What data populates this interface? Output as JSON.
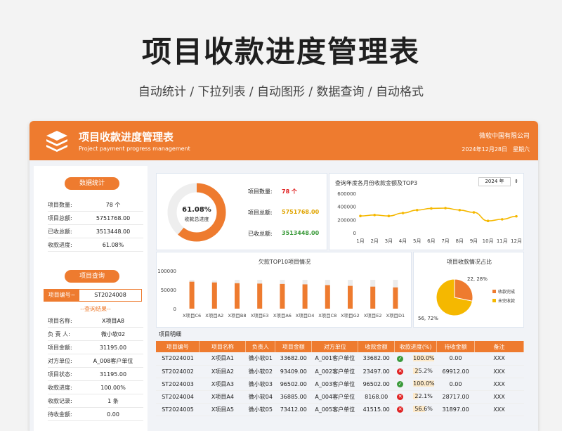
{
  "title": "项目收款进度管理表",
  "subtitle": "自动统计 / 下拉列表 / 自动图形 / 数据查询 / 自动格式",
  "header": {
    "title": "项目收款进度管理表",
    "subtitle": "Project payment progress management",
    "company": "微软中国有限公司",
    "date": "2024年12月28日　星期六"
  },
  "stats": {
    "label": "数据统计",
    "items": [
      {
        "k": "项目数量:",
        "v": "78 个"
      },
      {
        "k": "项目总额:",
        "v": "5751768.00"
      },
      {
        "k": "已收总额:",
        "v": "3513448.00"
      },
      {
        "k": "收款进度:",
        "v": "61.08%"
      }
    ]
  },
  "query": {
    "label": "项目查询",
    "key": "项目编号~",
    "value": "ST2024008",
    "divider": "--查询结果--",
    "items": [
      {
        "k": "项目名称:",
        "v": "X项目A8"
      },
      {
        "k": "负 责 人:",
        "v": "微小软02"
      },
      {
        "k": "项目金额:",
        "v": "31195.00"
      },
      {
        "k": "对方单位:",
        "v": "A_008客户单位"
      },
      {
        "k": "项目状态:",
        "v": "31195.00"
      },
      {
        "k": "收款进度:",
        "v": "100.00%"
      },
      {
        "k": "收款记录:",
        "v": "1 条"
      },
      {
        "k": "待收金额:",
        "v": "0.00"
      }
    ]
  },
  "summary": {
    "percent": "61.08%",
    "percent_label": "收款总进度",
    "progress": 0.6108,
    "count_label": "项目数量:",
    "count_value": "78 个",
    "total_label": "项目总额:",
    "total_value": "5751768.00",
    "received_label": "已收总额:",
    "received_value": "3513448.00"
  },
  "colors": {
    "accent": "#ee7b2f",
    "yellow": "#f5b800",
    "green": "#3a9a3a",
    "red": "#e02020"
  },
  "monthly": {
    "title": "查询年度各月份收款金额及TOP3",
    "year": "2024 年",
    "chart_data": {
      "type": "line",
      "categories": [
        "1月",
        "2月",
        "3月",
        "4月",
        "5月",
        "6月",
        "7月",
        "8月",
        "9月",
        "10月",
        "11月",
        "12月"
      ],
      "values": [
        255000,
        270000,
        255000,
        300000,
        345000,
        370000,
        375000,
        345000,
        310000,
        180000,
        205000,
        250000
      ],
      "yticks": [
        "600000",
        "400000",
        "200000",
        "0"
      ],
      "ylim": [
        0,
        600000
      ]
    }
  },
  "top10": {
    "title": "欠款TOP10项目情况",
    "chart_data": {
      "type": "bar",
      "categories": [
        "X项目C6",
        "X项目A2",
        "X项目B8",
        "X项目E3",
        "X项目A6",
        "X项目D4",
        "X项目C8",
        "X项目G2",
        "X项目E2",
        "X项目D1"
      ],
      "values": [
        71000,
        69000,
        67000,
        66000,
        65000,
        64000,
        62000,
        60000,
        58000,
        56000
      ],
      "totals": [
        76000,
        74000,
        76000,
        76000,
        76000,
        76000,
        76000,
        76000,
        76000,
        76000
      ],
      "yticks": [
        "100000",
        "50000",
        "0"
      ],
      "ylim": [
        0,
        100000
      ]
    }
  },
  "pie": {
    "title": "项目收款情况占比",
    "label_done": "22, 28%",
    "label_undone": "56, 72%",
    "chart_data": {
      "type": "pie",
      "series": [
        {
          "name": "收款完成",
          "value": 22
        },
        {
          "name": "未完收款",
          "value": 56
        }
      ]
    }
  },
  "table": {
    "title": "项目明细",
    "headers": [
      "项目编号",
      "项目名称",
      "负责人",
      "项目金额",
      "对方单位",
      "收款金额",
      "收款进度(%)",
      "待收金额",
      "备注"
    ],
    "rows": [
      {
        "id": "ST2024001",
        "name": "X项目A1",
        "owner": "微小软01",
        "amount": "33682.00",
        "unit": "A_001客户单位",
        "paid": "33682.00",
        "done": true,
        "pct": "100.0%",
        "due": "0.00",
        "note": "XXX"
      },
      {
        "id": "ST2024002",
        "name": "X项目A2",
        "owner": "微小软02",
        "amount": "93409.00",
        "unit": "A_002客户单位",
        "paid": "23497.00",
        "done": false,
        "pct": "25.2%",
        "due": "69912.00",
        "note": "XXX"
      },
      {
        "id": "ST2024003",
        "name": "X项目A3",
        "owner": "微小软03",
        "amount": "96502.00",
        "unit": "A_003客户单位",
        "paid": "96502.00",
        "done": true,
        "pct": "100.0%",
        "due": "0.00",
        "note": "XXX"
      },
      {
        "id": "ST2024004",
        "name": "X项目A4",
        "owner": "微小软04",
        "amount": "36885.00",
        "unit": "A_004客户单位",
        "paid": "8168.00",
        "done": false,
        "pct": "22.1%",
        "due": "28717.00",
        "note": "XXX"
      },
      {
        "id": "ST2024005",
        "name": "X项目A5",
        "owner": "微小软05",
        "amount": "73412.00",
        "unit": "A_005客户单位",
        "paid": "41515.00",
        "done": false,
        "pct": "56.6%",
        "due": "31897.00",
        "note": "XXX"
      }
    ]
  }
}
